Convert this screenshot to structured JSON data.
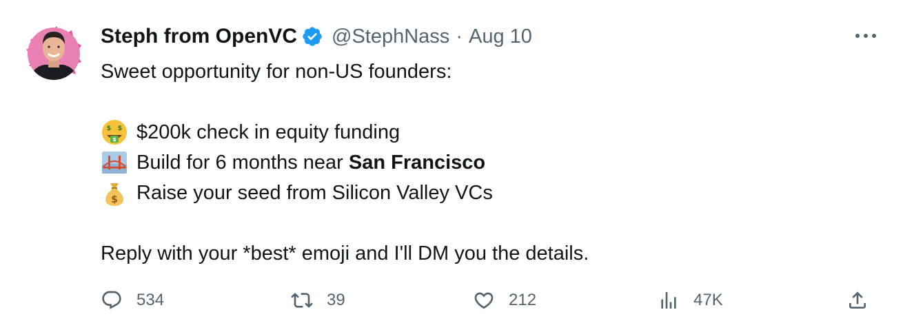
{
  "tweet": {
    "author": {
      "name": "Steph from OpenVC",
      "handle": "@StephNass",
      "separator": "·",
      "date": "Aug 10",
      "verified_icon": "verified-badge-icon",
      "verified_color": "#1d9bf0"
    },
    "body": {
      "intro": "Sweet opportunity for non-US founders:",
      "bullet1": {
        "icon": "money-mouth-face-emoji",
        "text": "$200k check in equity funding"
      },
      "bullet2": {
        "icon": "bridge-at-night-emoji",
        "text_prefix": "Build for 6 months near ",
        "text_bold": "San Francisco"
      },
      "bullet3": {
        "icon": "money-bag-emoji",
        "text": "Raise your seed from Silicon Valley VCs"
      },
      "closing": "Reply with your *best* emoji and I'll DM you the details."
    },
    "actions": {
      "replies": {
        "icon": "reply-icon",
        "count": "534"
      },
      "retweets": {
        "icon": "retweet-icon",
        "count": "39"
      },
      "likes": {
        "icon": "like-icon",
        "count": "212"
      },
      "views": {
        "icon": "views-icon",
        "count": "47K"
      },
      "share": {
        "icon": "share-icon"
      }
    },
    "more_icon": "more-options-icon"
  },
  "colors": {
    "text": "#0f1419",
    "muted": "#536471",
    "accent": "#1d9bf0"
  }
}
